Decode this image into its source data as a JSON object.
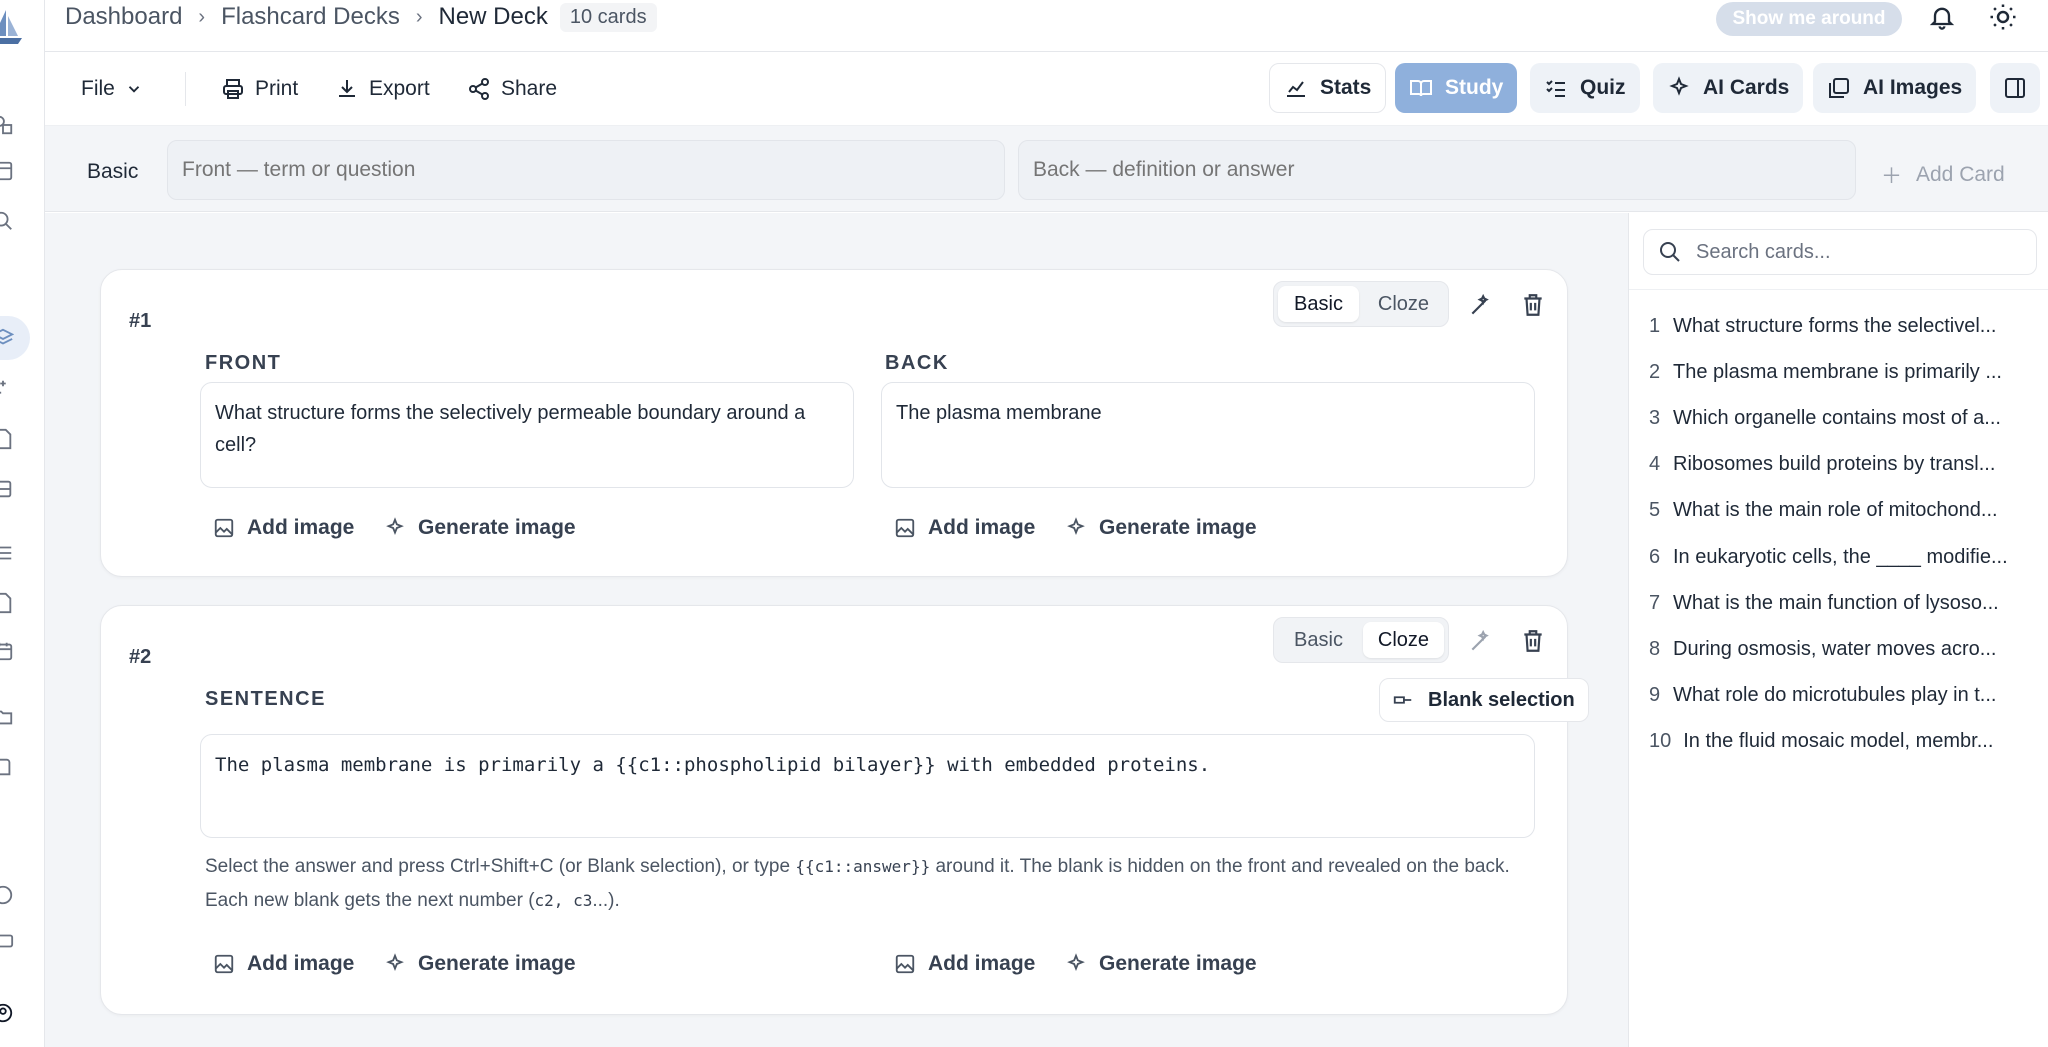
{
  "breadcrumb": {
    "items": [
      "Dashboard",
      "Flashcard Decks",
      "New Deck"
    ],
    "card_count": "10 cards"
  },
  "header": {
    "tour_label": "Show me around"
  },
  "toolbar": {
    "file": "File",
    "print": "Print",
    "export": "Export",
    "share": "Share",
    "stats": "Stats",
    "study": "Study",
    "quiz": "Quiz",
    "ai_cards": "AI Cards",
    "ai_images": "AI Images"
  },
  "add_row": {
    "type_label": "Basic",
    "front_placeholder": "Front — term or question",
    "back_placeholder": "Back — definition or answer",
    "add_card": "Add Card"
  },
  "cards": [
    {
      "number": "#1",
      "mode_basic": "Basic",
      "mode_cloze": "Cloze",
      "active_mode": "Basic",
      "front_label": "FRONT",
      "back_label": "BACK",
      "front": "What structure forms the selectively permeable boundary around a cell?",
      "back": "The plasma membrane",
      "add_image": "Add image",
      "generate_image": "Generate image"
    },
    {
      "number": "#2",
      "mode_basic": "Basic",
      "mode_cloze": "Cloze",
      "active_mode": "Cloze",
      "sentence_label": "SENTENCE",
      "blank_selection": "Blank selection",
      "sentence": "The plasma membrane is primarily a {{c1::phospholipid bilayer}} with embedded proteins.",
      "hint_part1": "Select the answer and press Ctrl+Shift+C (or Blank selection), or type",
      "hint_code": "{{c1::answer}}",
      "hint_part2": "around it. The blank is hidden on the front and revealed on the back. Each new blank gets the next number (",
      "hint_code2": "c2, c3",
      "hint_part3": "...).",
      "add_image": "Add image",
      "generate_image": "Generate image"
    }
  ],
  "side_panel": {
    "search_placeholder": "Search cards...",
    "items": [
      {
        "n": "1",
        "text": "What structure forms the selectivel..."
      },
      {
        "n": "2",
        "text": "The plasma membrane is primarily ..."
      },
      {
        "n": "3",
        "text": "Which organelle contains most of a..."
      },
      {
        "n": "4",
        "text": "Ribosomes build proteins by transl..."
      },
      {
        "n": "5",
        "text": "What is the main role of mitochond..."
      },
      {
        "n": "6",
        "text": "In eukaryotic cells, the ____ modifie..."
      },
      {
        "n": "7",
        "text": "What is the main function of lysoso..."
      },
      {
        "n": "8",
        "text": "During osmosis, water moves acro..."
      },
      {
        "n": "9",
        "text": "What role do microtubules play in t..."
      },
      {
        "n": "10",
        "text": "In the fluid mosaic model, membr..."
      }
    ]
  }
}
